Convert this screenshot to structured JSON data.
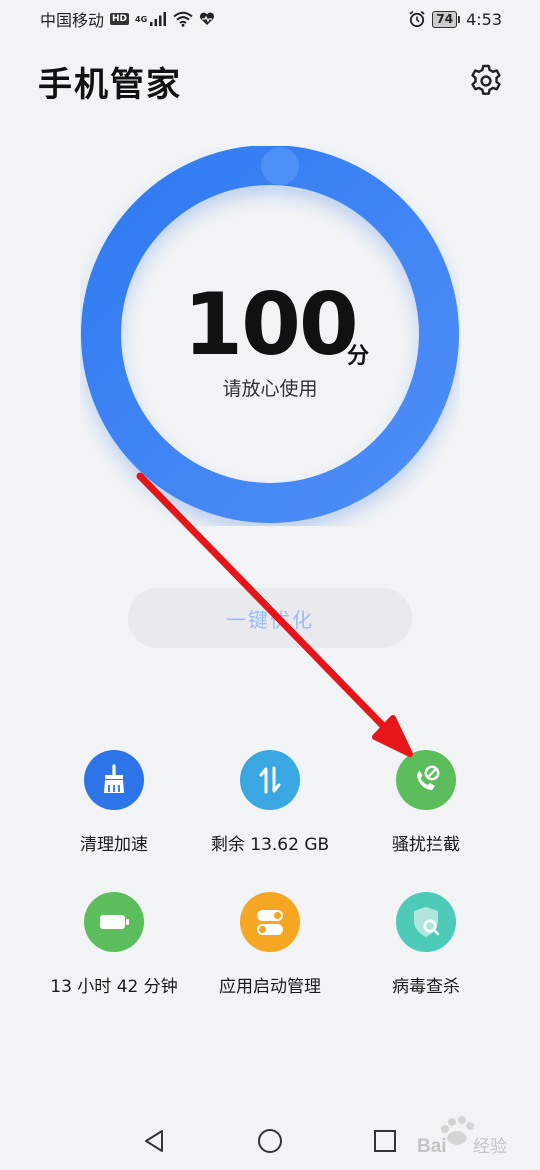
{
  "status_bar": {
    "carrier": "中国移动",
    "hd": "HD",
    "network": "4G",
    "battery": "74",
    "time": "4:53"
  },
  "header": {
    "title": "手机管家",
    "settings_icon": "gear-icon"
  },
  "score": {
    "value": "100",
    "unit": "分",
    "status": "请放心使用",
    "level": 1.0,
    "colors": {
      "ring_start": "#2f7bf0",
      "ring_end": "#4f8ef7"
    }
  },
  "optimize_button": {
    "label": "一键优化"
  },
  "tools": [
    {
      "label": "清理加速",
      "icon": "broom-icon",
      "color": "#2d74e8"
    },
    {
      "label": "剩余 13.62 GB",
      "icon": "storage-arrows-icon",
      "color": "#3aa7e3"
    },
    {
      "label": "骚扰拦截",
      "icon": "phone-block-icon",
      "color": "#5cbd5c"
    },
    {
      "label": "13 小时 42 分钟",
      "icon": "battery-icon",
      "color": "#5cbd5c"
    },
    {
      "label": "应用启动管理",
      "icon": "toggle-switch-icon",
      "color": "#f5a623"
    },
    {
      "label": "病毒查杀",
      "icon": "shield-search-icon",
      "color": "#4ecab8"
    }
  ],
  "annotation": {
    "arrow_color": "#e5161a"
  },
  "nav": {
    "back": "back-icon",
    "home": "home-icon",
    "recents": "recents-icon"
  },
  "watermark": {
    "text": "Bai经验"
  }
}
